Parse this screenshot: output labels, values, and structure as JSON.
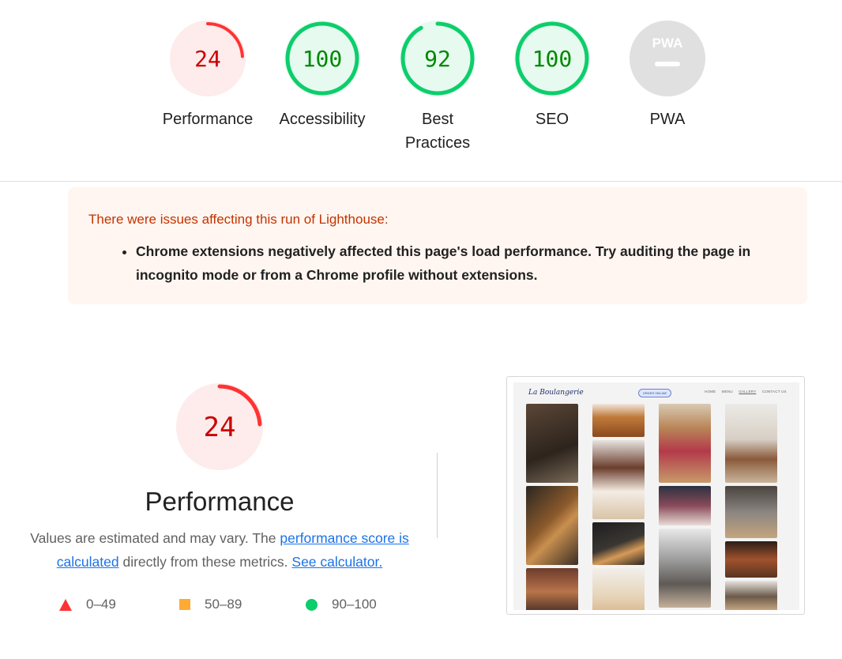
{
  "scores": [
    {
      "label": "Performance",
      "score": "24",
      "value": 0.24,
      "status": "fail"
    },
    {
      "label": "Accessibility",
      "score": "100",
      "value": 1.0,
      "status": "pass"
    },
    {
      "label": "Best Practices",
      "score": "92",
      "value": 0.92,
      "status": "pass"
    },
    {
      "label": "SEO",
      "score": "100",
      "value": 1.0,
      "status": "pass"
    },
    {
      "label": "PWA",
      "badge": "PWA",
      "status": "na"
    }
  ],
  "colors": {
    "fail": "#ff3333",
    "fail_bg": "#fdeceb",
    "fail_text": "#cc0000",
    "pass": "#0cce6b",
    "pass_bg": "#e6faf0",
    "pass_text": "#008800",
    "average": "#ffaa33",
    "na_bg": "#e0e0e0",
    "link": "#1a73e8"
  },
  "warning": {
    "title": "There were issues affecting this run of Lighthouse:",
    "items": [
      "Chrome extensions negatively affected this page's load performance. Try auditing the page in incognito mode or from a Chrome profile without extensions."
    ]
  },
  "performance": {
    "score": "24",
    "value": 0.24,
    "title": "Performance",
    "desc_prefix": "Values are estimated and may vary. The ",
    "link_score": "performance score is calculated",
    "desc_middle": " directly from these metrics. ",
    "link_calculator": "See calculator."
  },
  "legend": [
    {
      "range": "0–49",
      "shape": "triangle",
      "color": "#ff3333"
    },
    {
      "range": "50–89",
      "shape": "square",
      "color": "#ffaa33"
    },
    {
      "range": "90–100",
      "shape": "circle",
      "color": "#0cce6b"
    }
  ],
  "screenshot": {
    "brand": "La Boulangerie",
    "order_button": "ORDER ONLINE",
    "nav": [
      "HOME",
      "MENU",
      "GALLERY",
      "CONTACT US"
    ],
    "active_nav": "GALLERY"
  }
}
